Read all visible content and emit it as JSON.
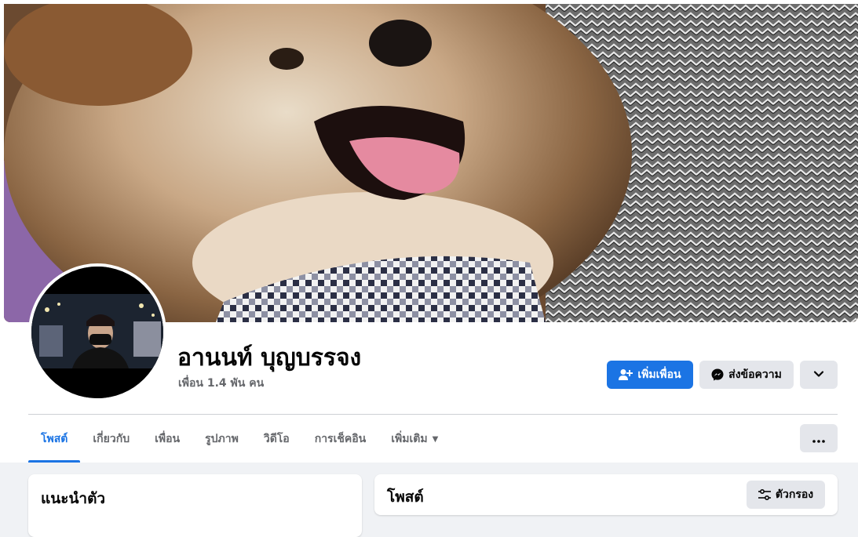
{
  "profile": {
    "name": "อานนท์ บุญบรรจง",
    "friends_count": "เพื่อน 1.4 พัน คน"
  },
  "actions": {
    "add_friend": "เพิ่มเพื่อน",
    "message": "ส่งข้อความ"
  },
  "tabs": [
    {
      "label": "โพสต์"
    },
    {
      "label": "เกี่ยวกับ"
    },
    {
      "label": "เพื่อน"
    },
    {
      "label": "รูปภาพ"
    },
    {
      "label": "วิดีโอ"
    },
    {
      "label": "การเช็คอิน"
    },
    {
      "label": "เพิ่มเติม"
    }
  ],
  "intro_card": {
    "title": "แนะนำตัว"
  },
  "posts_card": {
    "title": "โพสต์",
    "filter_label": "ตัวกรอง"
  },
  "icons": {
    "add_friend": "person-plus-icon",
    "message": "messenger-icon",
    "dropdown": "chevron-down-icon",
    "more": "more-dots-icon",
    "filter": "sliders-icon"
  },
  "colors": {
    "accent": "#1b74e4",
    "button_gray": "#e4e6eb",
    "secondary_text": "#65676b",
    "background": "#f0f2f5"
  }
}
